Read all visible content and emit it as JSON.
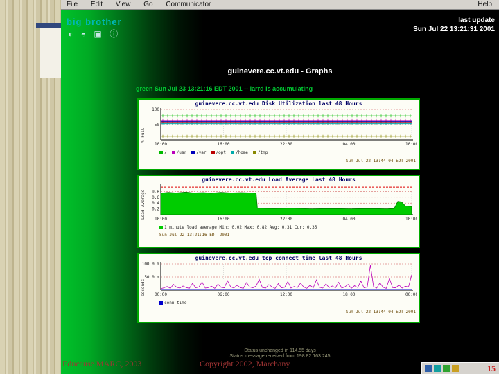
{
  "slide": {
    "footer_left": "Educause MARC, 2003",
    "footer_center": "Copyright 2002, Marchany",
    "page_number": "15"
  },
  "browser": {
    "menu": {
      "items": [
        "File",
        "Edit",
        "View",
        "Go",
        "Communicator"
      ],
      "help": "Help"
    },
    "logo_text": "big brother",
    "logo_icons": [
      "◐",
      "◓",
      "▣",
      "ⓘ"
    ],
    "last_update_label": "last update",
    "last_update_time": "Sun Jul 22 13:21:31 2001",
    "page_title": "guinevere.cc.vt.edu - Graphs",
    "status_line": "green Sun Jul 23 13:21:16 EDT 2001 -- larrd is accumulating",
    "status_footer_1": "Status unchanged in 114.55 days",
    "status_footer_2": "Status message received from 198.82.163.245"
  },
  "chart_data": [
    {
      "type": "flatlines",
      "title": "guinevere.cc.vt.edu Disk Utilization last 48 Hours",
      "ylabel": "% Full",
      "ylim": [
        0,
        100
      ],
      "yticks": [
        {
          "v": 100,
          "label": "100"
        },
        {
          "v": 50,
          "label": "50"
        }
      ],
      "xticks": [
        "10:00",
        "16:00",
        "22:00",
        "04:00",
        "10:00"
      ],
      "series": [
        {
          "name": "/",
          "color": "#00bb00",
          "value": 79
        },
        {
          "name": "/usr",
          "color": "#bb00bb",
          "value": 64
        },
        {
          "name": "/var",
          "color": "#0000bb",
          "value": 60
        },
        {
          "name": "/opt",
          "color": "#bb0000",
          "value": 57
        },
        {
          "name": "/home",
          "color": "#00aaaa",
          "value": 53
        },
        {
          "name": "/tmp",
          "color": "#888800",
          "value": 12
        }
      ],
      "legend": [
        {
          "color": "#00bb00",
          "label": "/"
        },
        {
          "color": "#bb00bb",
          "label": "/usr"
        },
        {
          "color": "#0000bb",
          "label": "/var"
        },
        {
          "color": "#bb0000",
          "label": "/opt"
        },
        {
          "color": "#00aaaa",
          "label": "/home"
        },
        {
          "color": "#888800",
          "label": "/tmp"
        }
      ],
      "timestamp": "Sun Jul 22 13:44:04 EDT 2001"
    },
    {
      "type": "area",
      "title": "guinevere.cc.vt.edu Load Average Last 48 Hours",
      "ylabel": "Load Average",
      "ylim": [
        0,
        1.0
      ],
      "yticks": [
        {
          "v": 0.8,
          "label": "0.8"
        },
        {
          "v": 0.6,
          "label": "0.6"
        },
        {
          "v": 0.4,
          "label": "0.4"
        },
        {
          "v": 0.2,
          "label": "0.2"
        }
      ],
      "xticks": [
        "10:00",
        "16:00",
        "22:00",
        "04:00",
        "10:00"
      ],
      "threshold": 0.95,
      "fill": "#00cc00",
      "stroke": "#007700",
      "points": [
        [
          0,
          0.74
        ],
        [
          0.03,
          0.77
        ],
        [
          0.06,
          0.75
        ],
        [
          0.1,
          0.78
        ],
        [
          0.13,
          0.75
        ],
        [
          0.17,
          0.76
        ],
        [
          0.2,
          0.74
        ],
        [
          0.24,
          0.77
        ],
        [
          0.28,
          0.75
        ],
        [
          0.32,
          0.76
        ],
        [
          0.36,
          0.75
        ],
        [
          0.38,
          0.74
        ],
        [
          0.385,
          0.22
        ],
        [
          0.45,
          0.21
        ],
        [
          0.52,
          0.22
        ],
        [
          0.6,
          0.2
        ],
        [
          0.68,
          0.21
        ],
        [
          0.76,
          0.2
        ],
        [
          0.84,
          0.21
        ],
        [
          0.9,
          0.2
        ],
        [
          0.93,
          0.21
        ],
        [
          0.945,
          0.46
        ],
        [
          0.96,
          0.44
        ],
        [
          0.975,
          0.3
        ],
        [
          1,
          0.28
        ]
      ],
      "legend": [
        {
          "color": "#00cc00",
          "label": "1 minute load average   Min: 0.02  Max: 0.82  Avg: 0.31  Cur: 0.35"
        }
      ],
      "timestamp": "Sun Jul 22 13:21:16 EDT 2001"
    },
    {
      "type": "spikes",
      "title": "guinevere.cc.vt.edu tcp connect time last 48 Hours",
      "ylabel": "seconds",
      "ylim": [
        0,
        100
      ],
      "yticks": [
        {
          "v": 100,
          "label": "100.0 m"
        },
        {
          "v": 50,
          "label": "50.0 m"
        }
      ],
      "xticks": [
        "00:00",
        "06:00",
        "12:00",
        "18:00",
        "00:00"
      ],
      "color": "#bb00bb",
      "baseline": 3,
      "baseline_color": "#0000cc",
      "values": [
        6,
        9,
        14,
        7,
        22,
        11,
        8,
        16,
        10,
        7,
        26,
        9,
        12,
        31,
        8,
        10,
        15,
        7,
        23,
        11,
        9,
        36,
        13,
        8,
        19,
        10,
        7,
        29,
        12,
        9,
        16,
        41,
        10,
        8,
        21,
        13,
        7,
        25,
        9,
        11,
        33,
        8,
        14,
        10,
        27,
        12,
        7,
        19,
        9,
        39,
        11,
        8,
        24,
        10,
        16,
        9,
        30,
        8,
        13,
        22,
        7,
        17,
        10,
        35,
        9,
        12,
        95,
        14,
        8,
        28,
        11,
        7,
        45,
        10,
        9,
        20,
        8,
        15,
        12,
        58
      ],
      "legend": [
        {
          "color": "#0000cc",
          "label": "conn time"
        }
      ],
      "timestamp": "Sun Jul 22 13:44:04 EDT 2001"
    }
  ]
}
